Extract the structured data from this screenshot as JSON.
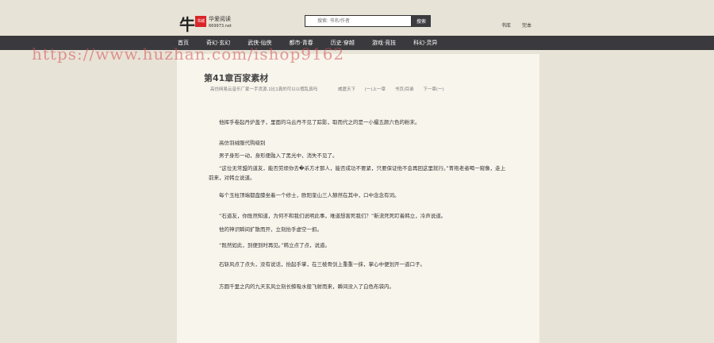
{
  "header": {
    "logo_main": "牛",
    "logo_badge": "书城",
    "logo_text": "华爱阅读",
    "logo_url": "669973.net",
    "search_placeholder": "搜索: 书名/作者",
    "search_button": "搜索",
    "links": [
      "书库",
      "完本"
    ]
  },
  "nav": [
    "首页",
    "奇幻·玄幻",
    "武侠·仙侠",
    "都市·青春",
    "历史·穿越",
    "游戏·竞技",
    "科幻·灵异"
  ],
  "watermark": "https://www.huzhan.com/ishop9162",
  "chapter": {
    "title": "第41章百家素材",
    "ad": "高仿网易云音乐厂家一手货源,1比1真的可以以假乱真吗",
    "book": "威震天下",
    "prev": "(一)上一章",
    "toc": "书页/目录",
    "next": "下一章(一)",
    "paragraphs": [
      "他挥手卷起丹炉盖子，里面的乌云丹不见了踪影，取而代之的是一小撮五颜六色的粉末。",
      "高仿羽绒服代购级别",
      "男子身形一动，身形便融入了黑光中，消失不见了。",
      "“这位无常盟的道友，能否劳烦你去�杀方才那人，能否成功不要紧，只要保证他不会再回这里就行。”青袍老者喝一窥像，走上前来，对韩立说道。",
      "每个玉柱顶端都盘膝坐着一个修士，欧阳奎山三人赫然在其中，口中念念有词。",
      "“石道友，你既然知道，为何不和我们说明此事，难道想害死我们？”靳流死死盯着韩立，冷声说道。",
      "他的神识瞬间扩散而开，立刻抬手虚空一抓。",
      "“既然如此，到便到时再见。”韩立点了点，说道。",
      "石斩风点了点头，没有说话，抬起手掌，在三棱骨剑上重重一抹，掌心中便划开一道口子。",
      "方圆千里之内的九天玄风立刻长鲸吸水般飞射而来，瞬间没入了白色布袋内。"
    ]
  }
}
